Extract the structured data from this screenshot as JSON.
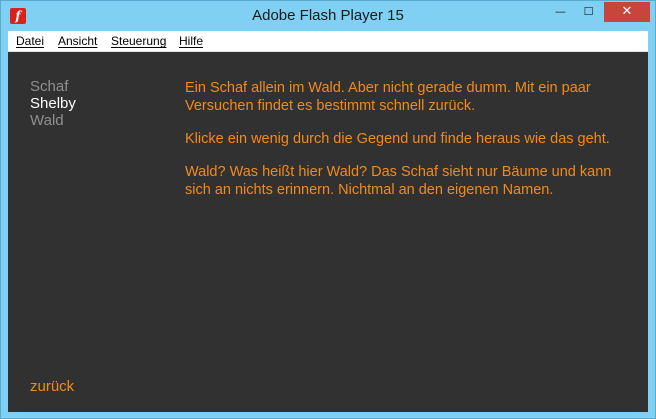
{
  "window": {
    "title": "Adobe Flash Player 15",
    "icon": "flash-icon",
    "buttons": {
      "minimize": "—",
      "maximize": "☐",
      "close": "✕"
    }
  },
  "menu": {
    "items": [
      "Datei",
      "Ansicht",
      "Steuerung",
      "Hilfe"
    ]
  },
  "nav": {
    "items": [
      {
        "label": "Schaf",
        "state": "inactive"
      },
      {
        "label": "Shelby",
        "state": "active"
      },
      {
        "label": "Wald",
        "state": "inactive"
      }
    ]
  },
  "story": {
    "paragraphs": [
      "Ein Schaf allein im Wald. Aber nicht gerade dumm. Mit ein paar Versuchen findet es bestimmt schnell zurück.",
      "Klicke ein wenig durch die Gegend und finde heraus wie das geht.",
      "Wald? Was heißt hier Wald? Das Schaf sieht nur Bäume und kann sich an nichts erinnern. Nichtmal an den eigenen Namen."
    ]
  },
  "back_label": "zurück",
  "colors": {
    "accent": "#f28a1b",
    "background": "#313131",
    "nav_active": "#ffffff",
    "nav_inactive": "#8f8f8f",
    "frame": "#7fd0f2",
    "close_button": "#c7453b"
  }
}
